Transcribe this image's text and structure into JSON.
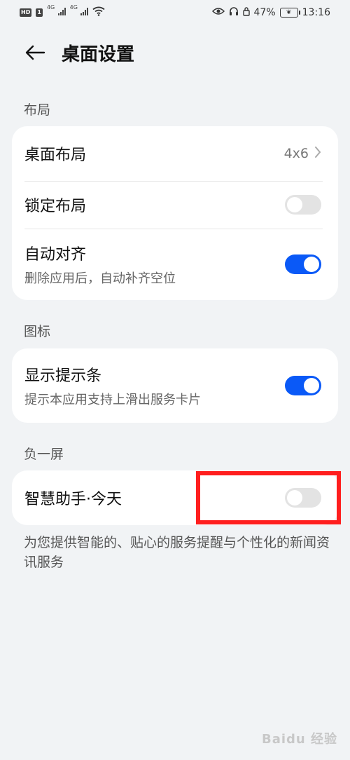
{
  "status_bar": {
    "hd_badge": "HD",
    "sim1": "1",
    "net1": "4G",
    "net2": "4G",
    "battery_percent": "47%",
    "time": "13:16",
    "icons": [
      "hd-icon",
      "signal-icon",
      "wifi-icon",
      "eye-icon",
      "headphones-icon",
      "lock-icon",
      "battery-icon"
    ]
  },
  "header": {
    "title": "桌面设置",
    "back_icon": "back-arrow-icon"
  },
  "sections": {
    "layout": {
      "label": "布局",
      "items": [
        {
          "title": "桌面布局",
          "value": "4x6"
        },
        {
          "title": "锁定布局",
          "toggle": "off"
        },
        {
          "title": "自动对齐",
          "subtitle": "删除应用后，自动补齐空位",
          "toggle": "on"
        }
      ]
    },
    "icons": {
      "label": "图标",
      "items": [
        {
          "title": "显示提示条",
          "subtitle": "提示本应用支持上滑出服务卡片",
          "toggle": "on"
        }
      ]
    },
    "minus_one": {
      "label": "负一屏",
      "items": [
        {
          "title": "智慧助手·今天",
          "toggle": "off"
        }
      ],
      "note": "为您提供智能的、贴心的服务提醒与个性化的新闻资讯服务"
    }
  },
  "watermark": "Baidu 经验",
  "colors": {
    "accent": "#0a59f7",
    "background": "#f1f3f5",
    "highlight": "#ff1e1e"
  }
}
